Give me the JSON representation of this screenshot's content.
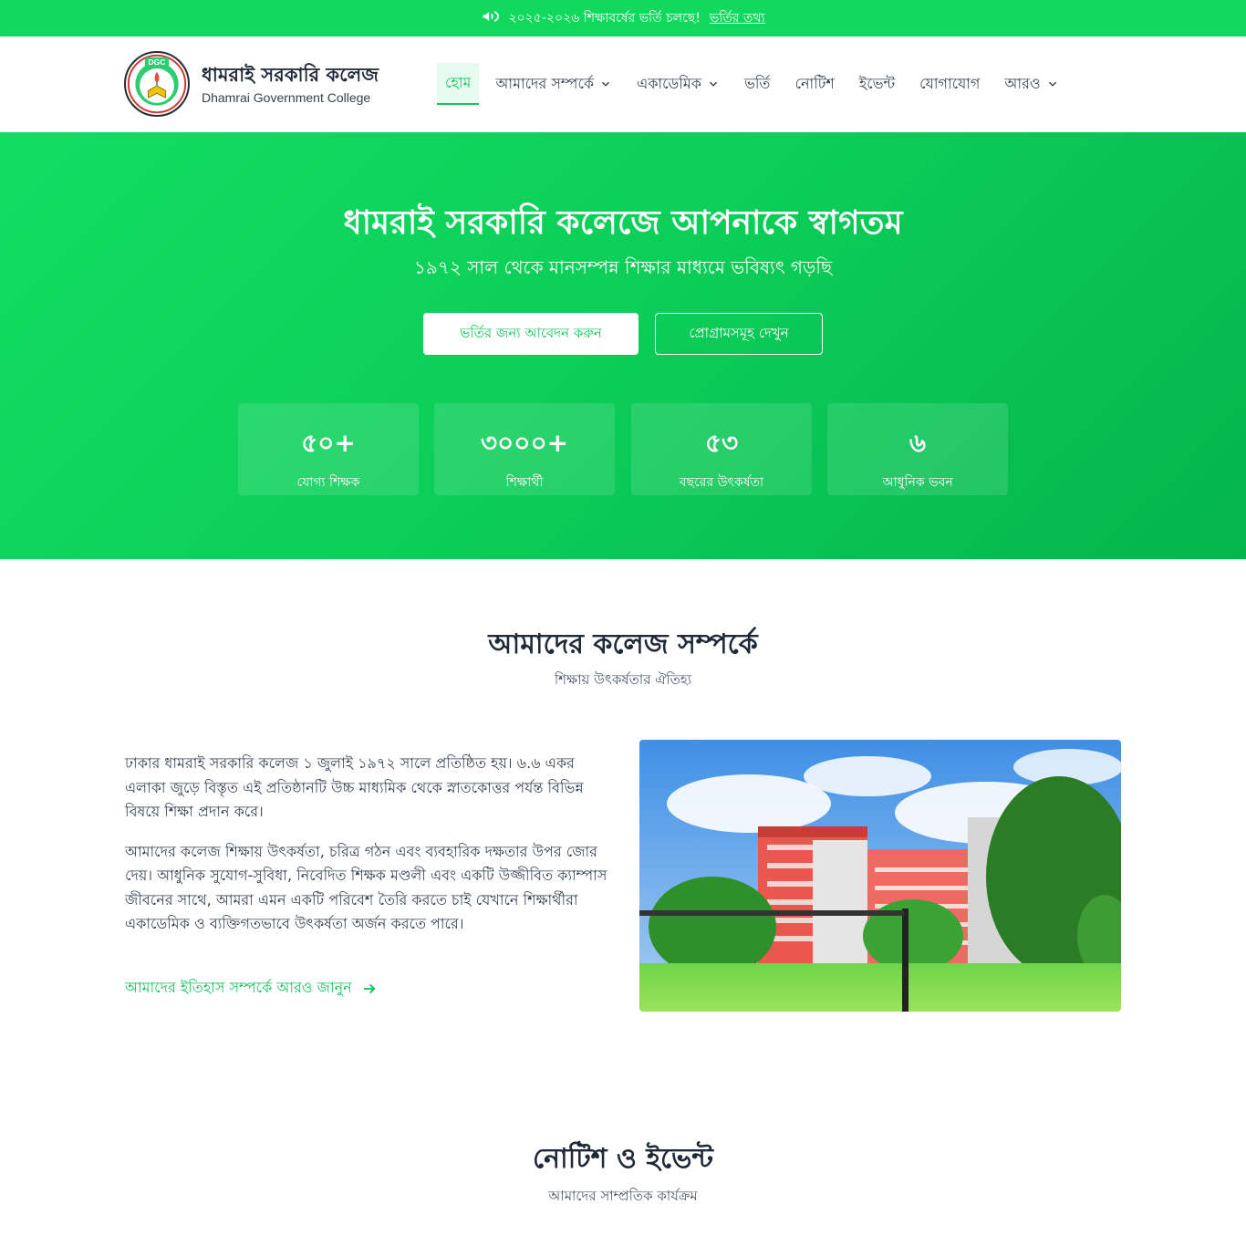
{
  "announcement": {
    "text": "২০২৫-২০২৬ শিক্ষাবর্ষের ভর্তি চলছে!",
    "link": "ভর্তির তথ্য",
    "icon": "megaphone-icon"
  },
  "brand": {
    "title": "ধামরাই সরকারি কলেজ",
    "subtitle": "Dhamrai Government College",
    "logo_text": "DGC"
  },
  "nav": {
    "items": [
      {
        "label": "হোম",
        "dropdown": false
      },
      {
        "label": "আমাদের সম্পর্কে",
        "dropdown": true
      },
      {
        "label": "একাডেমিক",
        "dropdown": true
      },
      {
        "label": "ভর্তি",
        "dropdown": false
      },
      {
        "label": "নোটিশ",
        "dropdown": false
      },
      {
        "label": "ইভেন্ট",
        "dropdown": false
      },
      {
        "label": "যোগাযোগ",
        "dropdown": false
      },
      {
        "label": "আরও",
        "dropdown": true
      }
    ]
  },
  "hero": {
    "title": "ধামরাই সরকারি কলেজে আপনাকে স্বাগতম",
    "subtitle": "১৯৭২ সাল থেকে মানসম্পন্ন শিক্ষার মাধ্যমে ভবিষ্যৎ গড়ছি",
    "primary_button": "ভর্তির জন্য আবেদন করুন",
    "secondary_button": "প্রোগ্রামসমূহ দেখুন",
    "stats": [
      {
        "value": "৫০+",
        "label": "যোগ্য শিক্ষক"
      },
      {
        "value": "৩০০০+",
        "label": "শিক্ষার্থী"
      },
      {
        "value": "৫৩",
        "label": "বছরের উৎকর্ষতা"
      },
      {
        "value": "৬",
        "label": "আধুনিক ভবন"
      }
    ]
  },
  "about": {
    "title": "আমাদের কলেজ সম্পর্কে",
    "subtitle": "শিক্ষায় উৎকর্ষতার ঐতিহ্য",
    "paragraph1": "ঢাকার ধামরাই সরকারি কলেজ ১ জুলাই ১৯৭২ সালে প্রতিষ্ঠিত হয়। ৬.৬ একর এলাকা জুড়ে বিস্তৃত এই প্রতিষ্ঠানটি উচ্চ মাধ্যমিক থেকে স্নাতকোত্তর পর্যন্ত বিভিন্ন বিষয়ে শিক্ষা প্রদান করে।",
    "paragraph2": "আমাদের কলেজ শিক্ষায় উৎকর্ষতা, চরিত্র গঠন এবং ব্যবহারিক দক্ষতার উপর জোর দেয়। আধুনিক সুযোগ-সুবিধা, নিবেদিত শিক্ষক মণ্ডলী এবং একটি উজ্জীবিত ক্যাম্পাস জীবনের সাথে, আমরা এমন একটি পরিবেশ তৈরি করতে চাই যেখানে শিক্ষার্থীরা একাডেমিক ও ব্যক্তিগতভাবে উৎকর্ষতা অর্জন করতে পারে।",
    "link": "আমাদের ইতিহাস সম্পর্কে আরও জানুন"
  },
  "notice": {
    "title": "নোটিশ ও ইভেন্ট",
    "subtitle": "আমাদের সাম্প্রতিক কার্যক্রম"
  },
  "colors": {
    "brand_green": "#10d95e",
    "accent_green": "#10c55a"
  }
}
